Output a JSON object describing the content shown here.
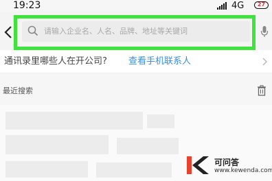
{
  "status_bar": {
    "time": "19:23",
    "network": "4G",
    "battery": "27",
    "battery_color": "#dd3333"
  },
  "search": {
    "placeholder": "请输入企业名、人名、品牌、地址等关键词",
    "highlight_color": "#3ee43b"
  },
  "contacts_banner": {
    "question": "通讯录里哪些人在开公司?",
    "link_label": "查看手机联系人",
    "link_color": "#3a8fde"
  },
  "recent": {
    "title": "最近搜索"
  },
  "watermark": {
    "logo_letter": "K",
    "title": "可问答",
    "url": "www.kewenda.com"
  },
  "icons": {
    "back": "back-icon",
    "search": "search-icon",
    "mic": "mic-icon",
    "chevron": "chevron-right-icon",
    "trash": "trash-icon"
  }
}
